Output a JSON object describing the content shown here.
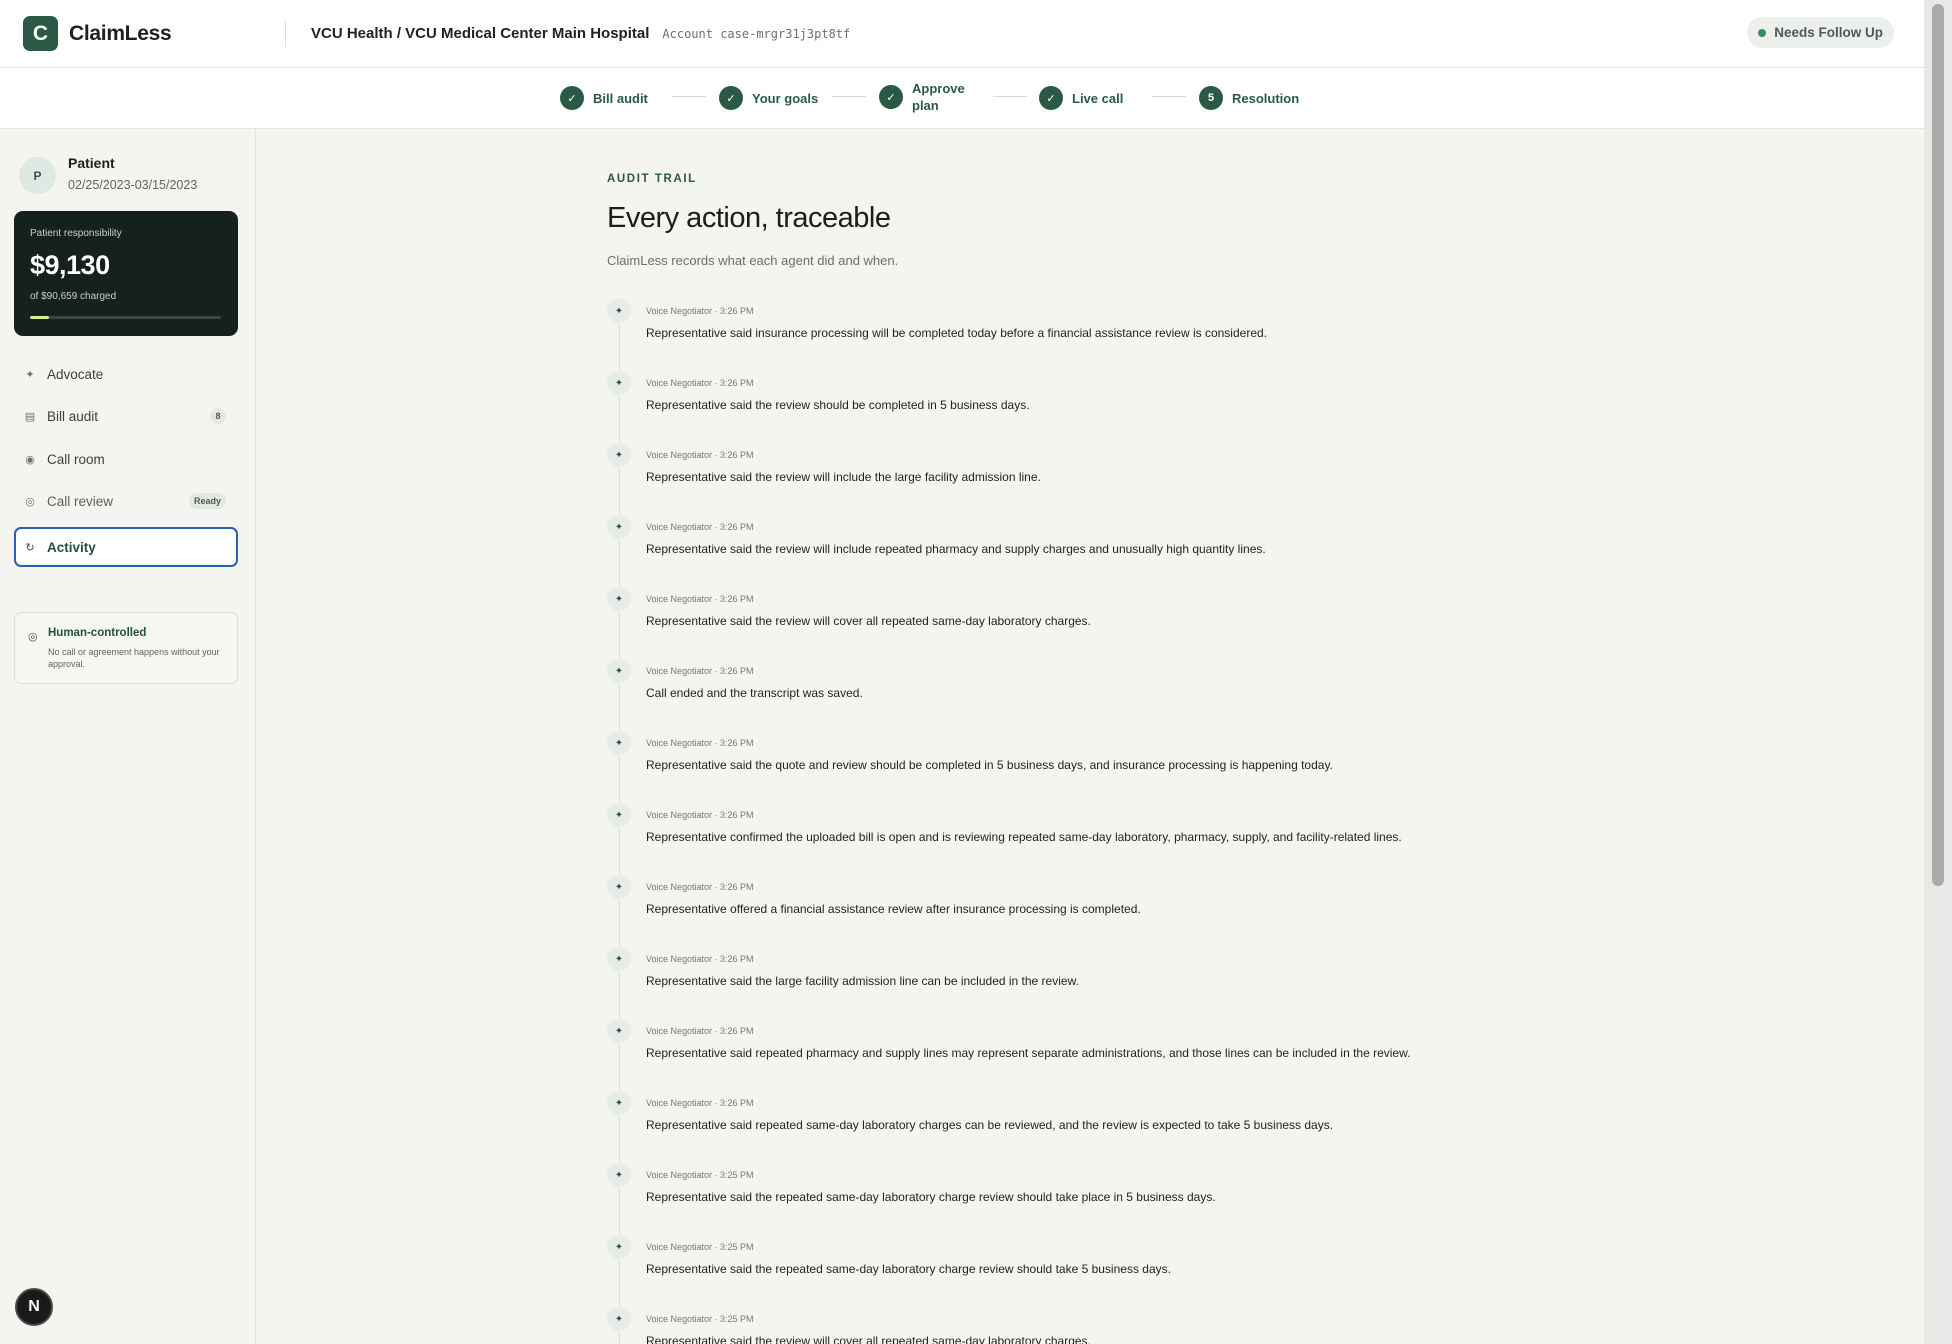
{
  "brand": {
    "logo_letter": "C",
    "name": "ClaimLess"
  },
  "header": {
    "title": "VCU Health / VCU Medical Center Main Hospital",
    "account": "Account case-mrgr31j3pt8tf",
    "status": "Needs Follow Up",
    "status_color": "#3d8a61"
  },
  "stepper": {
    "steps": [
      {
        "label": "Bill audit",
        "marker": "✓"
      },
      {
        "label": "Your goals",
        "marker": "✓"
      },
      {
        "label": "Approve plan",
        "marker": "✓"
      },
      {
        "label": "Live call",
        "marker": "✓"
      },
      {
        "label": "Resolution",
        "marker": "5"
      }
    ]
  },
  "sidebar": {
    "patient": {
      "initial": "P",
      "name": "Patient",
      "dates": "02/25/2023-03/15/2023"
    },
    "responsibility": {
      "label": "Patient responsibility",
      "amount": "$9,130",
      "charged": "of $90,659 charged",
      "progress_fraction": 0.1,
      "accent": "#d8f08c"
    },
    "nav": [
      {
        "label": "Advocate",
        "icon": "sparkle-icon",
        "glyph": "✦"
      },
      {
        "label": "Bill audit",
        "icon": "document-icon",
        "glyph": "▤",
        "badge": "8"
      },
      {
        "label": "Call room",
        "icon": "record-icon",
        "glyph": "◉"
      },
      {
        "label": "Call review",
        "icon": "circle-icon",
        "glyph": "◎",
        "badge": "Ready"
      },
      {
        "label": "Activity",
        "icon": "refresh-icon",
        "glyph": "↻",
        "active": true
      }
    ],
    "human_controlled": {
      "title": "Human-controlled",
      "text": "No call or agreement happens without your approval."
    },
    "n_badge": "N"
  },
  "main": {
    "eyebrow": "AUDIT TRAIL",
    "title": "Every action, traceable",
    "subtitle": "ClaimLess records what each agent did and when.",
    "entries": [
      {
        "meta": "Voice Negotiator · 3:26 PM",
        "text": "Representative said insurance processing will be completed today before a financial assistance review is considered."
      },
      {
        "meta": "Voice Negotiator · 3:26 PM",
        "text": "Representative said the review should be completed in 5 business days."
      },
      {
        "meta": "Voice Negotiator · 3:26 PM",
        "text": "Representative said the review will include the large facility admission line."
      },
      {
        "meta": "Voice Negotiator · 3:26 PM",
        "text": "Representative said the review will include repeated pharmacy and supply charges and unusually high quantity lines."
      },
      {
        "meta": "Voice Negotiator · 3:26 PM",
        "text": "Representative said the review will cover all repeated same-day laboratory charges."
      },
      {
        "meta": "Voice Negotiator · 3:26 PM",
        "text": "Call ended and the transcript was saved."
      },
      {
        "meta": "Voice Negotiator · 3:26 PM",
        "text": "Representative said the quote and review should be completed in 5 business days, and insurance processing is happening today."
      },
      {
        "meta": "Voice Negotiator · 3:26 PM",
        "text": "Representative confirmed the uploaded bill is open and is reviewing repeated same-day laboratory, pharmacy, supply, and facility-related lines."
      },
      {
        "meta": "Voice Negotiator · 3:26 PM",
        "text": "Representative offered a financial assistance review after insurance processing is completed."
      },
      {
        "meta": "Voice Negotiator · 3:26 PM",
        "text": "Representative said the large facility admission line can be included in the review."
      },
      {
        "meta": "Voice Negotiator · 3:26 PM",
        "text": "Representative said repeated pharmacy and supply lines may represent separate administrations, and those lines can be included in the review."
      },
      {
        "meta": "Voice Negotiator · 3:26 PM",
        "text": "Representative said repeated same-day laboratory charges can be reviewed, and the review is expected to take 5 business days."
      },
      {
        "meta": "Voice Negotiator · 3:25 PM",
        "text": "Representative said the repeated same-day laboratory charge review should take place in 5 business days."
      },
      {
        "meta": "Voice Negotiator · 3:25 PM",
        "text": "Representative said the repeated same-day laboratory charge review should take 5 business days."
      },
      {
        "meta": "Voice Negotiator · 3:25 PM",
        "text": "Representative said the review will cover all repeated same-day laboratory charges."
      }
    ]
  }
}
